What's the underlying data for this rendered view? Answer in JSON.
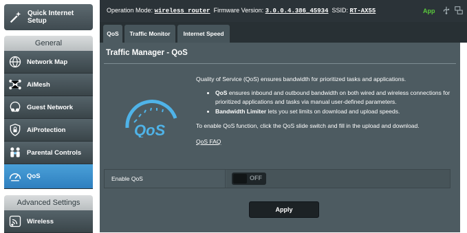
{
  "sidebar": {
    "quick_setup": "Quick Internet Setup",
    "general_header": "General",
    "general_items": [
      {
        "label": "Network Map",
        "icon": "network-map-icon"
      },
      {
        "label": "AiMesh",
        "icon": "aimesh-icon"
      },
      {
        "label": "Guest Network",
        "icon": "guest-network-icon"
      },
      {
        "label": "AiProtection",
        "icon": "shield-lock-icon"
      },
      {
        "label": "Parental Controls",
        "icon": "family-icon"
      },
      {
        "label": "QoS",
        "icon": "speedometer-icon",
        "active": true
      }
    ],
    "advanced_header": "Advanced Settings",
    "advanced_items": [
      {
        "label": "Wireless",
        "icon": "wireless-icon"
      }
    ]
  },
  "topbar": {
    "opmode_label": "Operation Mode:",
    "opmode_value": "wireless router",
    "fw_label": "Firmware Version:",
    "fw_value": "3.0.0.4.386_45934",
    "ssid_label": "SSID:",
    "ssid_value": "RT-AX55",
    "app_label": "App"
  },
  "tabs": [
    {
      "label": "QoS",
      "active": true
    },
    {
      "label": "Traffic Monitor"
    },
    {
      "label": "Internet Speed"
    }
  ],
  "main": {
    "title": "Traffic Manager - QoS",
    "intro": "Quality of Service (QoS) ensures bandwidth for prioritized tasks and applications.",
    "bullets": [
      {
        "bold": "QoS",
        "text": " ensures inbound and outbound bandwidth on both wired and wireless connections for prioritized applications and tasks via manual user-defined parameters."
      },
      {
        "bold": "Bandwidth Limiter",
        "text": " lets you set limits on download and upload speeds."
      }
    ],
    "enable_note": "To enable QoS function, click the QoS slide switch and fill in the upload and download.",
    "faq_link": "QoS FAQ",
    "enable_label": "Enable QoS",
    "switch_state": "OFF",
    "apply_label": "Apply",
    "logo_text": "QoS"
  },
  "colors": {
    "accent": "#2e7fbf",
    "app_green": "#5ac83c",
    "panel": "#4d5b61"
  }
}
